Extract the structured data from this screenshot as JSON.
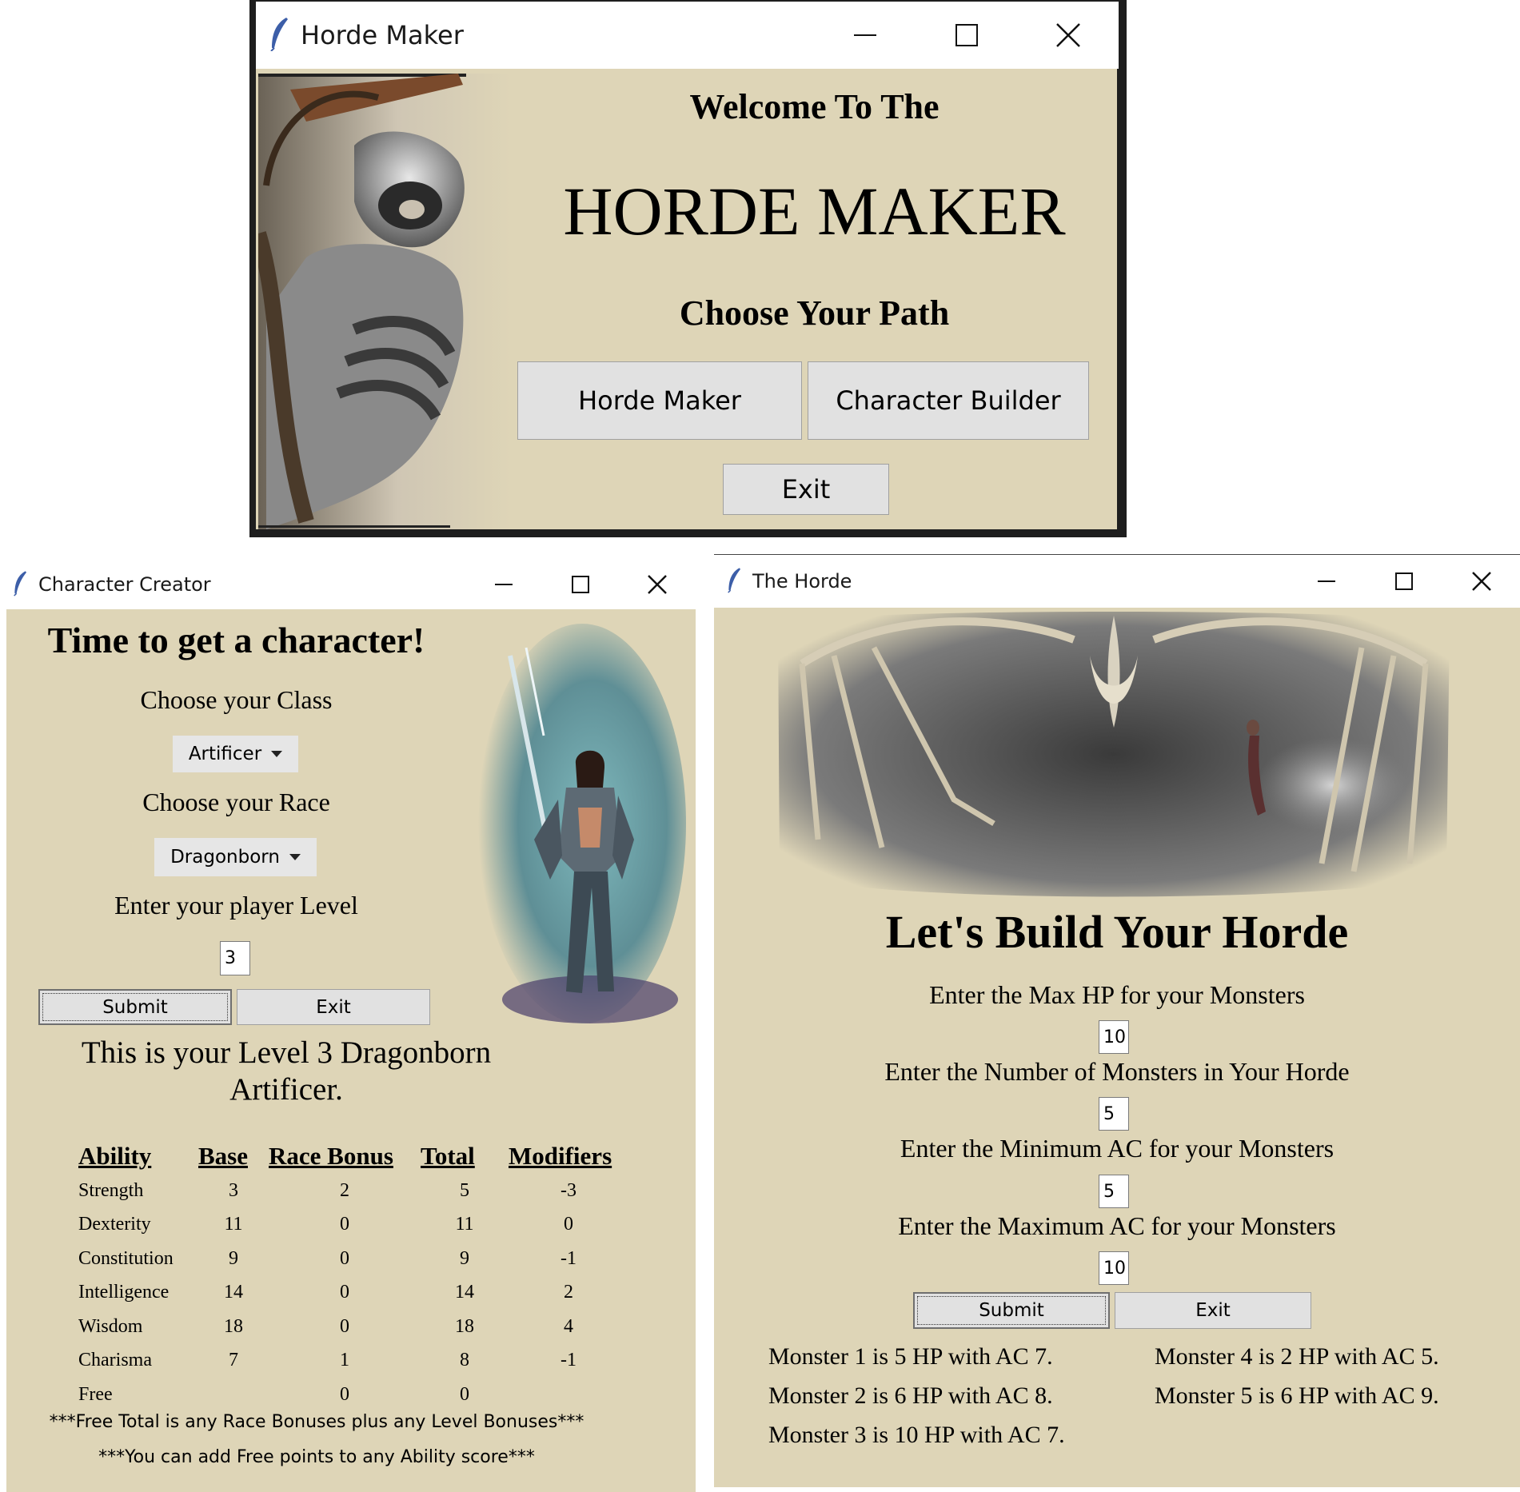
{
  "main_window": {
    "title": "Horde Maker",
    "welcome": "Welcome To The",
    "app_name": "HORDE MAKER",
    "subtitle": "Choose Your Path",
    "horde_button": "Horde Maker",
    "character_button": "Character Builder",
    "exit_button": "Exit"
  },
  "character_window": {
    "title": "Character Creator",
    "heading": "Time to get a character!",
    "class_label": "Choose your Class",
    "class_value": "Artificer",
    "race_label": "Choose your Race",
    "race_value": "Dragonborn",
    "level_label": "Enter your player Level",
    "level_value": "3",
    "submit_button": "Submit",
    "exit_button": "Exit",
    "result_line1": "This is your Level 3 Dragonborn",
    "result_line2": "Artificer.",
    "table_headers": [
      "Ability",
      "Base",
      "Race Bonus",
      "Total",
      "Modifiers"
    ],
    "rows": [
      {
        "ability": "Strength",
        "base": "3",
        "race": "2",
        "total": "5",
        "mod": "-3"
      },
      {
        "ability": "Dexterity",
        "base": "11",
        "race": "0",
        "total": "11",
        "mod": "0"
      },
      {
        "ability": "Constitution",
        "base": "9",
        "race": "0",
        "total": "9",
        "mod": "-1"
      },
      {
        "ability": "Intelligence",
        "base": "14",
        "race": "0",
        "total": "14",
        "mod": "2"
      },
      {
        "ability": "Wisdom",
        "base": "18",
        "race": "0",
        "total": "18",
        "mod": "4"
      },
      {
        "ability": "Charisma",
        "base": "7",
        "race": "1",
        "total": "8",
        "mod": "-1"
      },
      {
        "ability": "Free",
        "base": "",
        "race": "0",
        "total": "0",
        "mod": ""
      }
    ],
    "note1": "***Free Total is any Race Bonuses plus any Level Bonuses***",
    "note2": "***You can add Free points to any Ability score***"
  },
  "horde_window": {
    "title": "The Horde",
    "heading": "Let's Build Your Horde",
    "max_hp_label": "Enter the Max HP for your Monsters",
    "max_hp_value": "10",
    "count_label": "Enter the Number of Monsters in Your Horde",
    "count_value": "5",
    "min_ac_label": "Enter the Minimum AC for your Monsters",
    "min_ac_value": "5",
    "max_ac_label": "Enter the Maximum AC for your Monsters",
    "max_ac_value": "10",
    "submit_button": "Submit",
    "exit_button": "Exit",
    "monsters": [
      "Monster 1 is 5 HP with AC 7.",
      "Monster 2 is 6 HP with AC 8.",
      "Monster 3 is 10 HP with AC 7.",
      "Monster 4 is 2 HP with AC 5.",
      "Monster 5 is 6 HP with AC 9."
    ]
  },
  "colors": {
    "client_bg": "#ded5b7",
    "button_bg": "#e1e1e1",
    "titlebar_bg": "#ffffff"
  }
}
